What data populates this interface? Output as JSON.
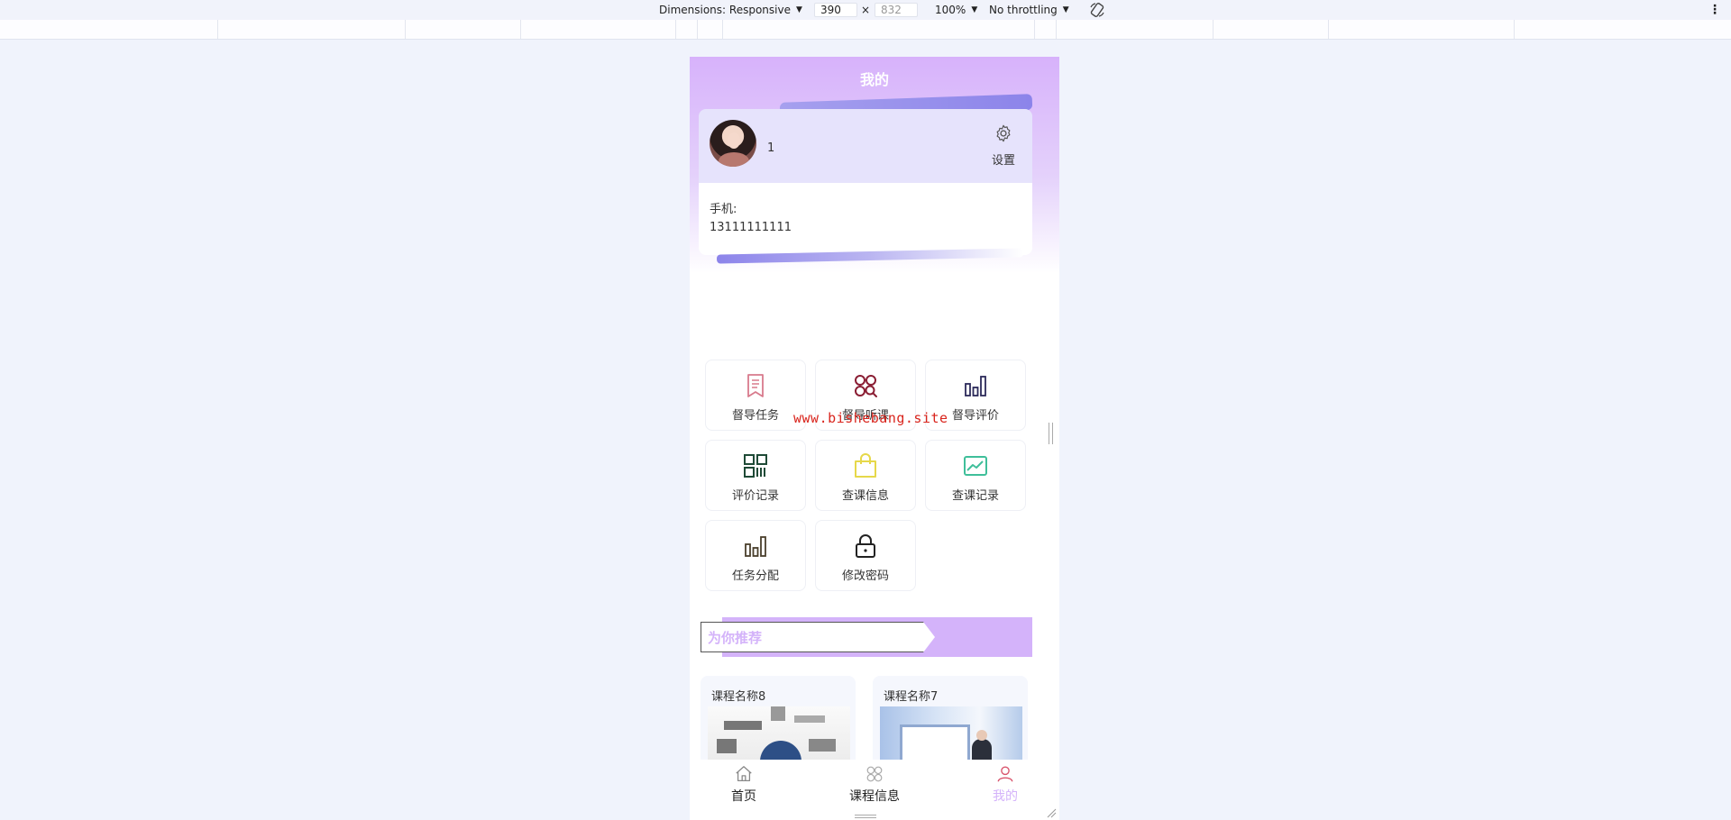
{
  "devtools": {
    "dimensions_label": "Dimensions: Responsive",
    "width_value": "390",
    "height_placeholder": "832",
    "zoom": "100%",
    "throttling": "No throttling",
    "rotate_icon": "rotate-icon",
    "more_icon": "kebab-icon"
  },
  "app": {
    "title": "我的",
    "accent_color": "#d4b3fa"
  },
  "user": {
    "name": "1",
    "settings_label": "设置",
    "phone_label": "手机:",
    "phone_value": "13111111111"
  },
  "menu": [
    {
      "label": "督导任务",
      "icon": "bookmark-icon",
      "color": "#d87a8c"
    },
    {
      "label": "督导听课",
      "icon": "circles-search-icon",
      "color": "#8a1d33"
    },
    {
      "label": "督导评价",
      "icon": "bar-chart-icon",
      "color": "#2c2a5a"
    },
    {
      "label": "评价记录",
      "icon": "qr-grid-icon",
      "color": "#1f4a36"
    },
    {
      "label": "查课信息",
      "icon": "shopping-bag-icon",
      "color": "#e6d84a"
    },
    {
      "label": "查课记录",
      "icon": "trend-image-icon",
      "color": "#3fbf9a"
    },
    {
      "label": "任务分配",
      "icon": "bar-chart-icon",
      "color": "#4a3f2c"
    },
    {
      "label": "修改密码",
      "icon": "lock-icon",
      "color": "#222222"
    }
  ],
  "watermark": "www.bishebang.site",
  "recommend": {
    "title": "为你推荐",
    "courses": [
      {
        "name": "课程名称8"
      },
      {
        "name": "课程名称7"
      }
    ]
  },
  "tabs": [
    {
      "label": "首页",
      "icon": "home-icon",
      "active": false
    },
    {
      "label": "课程信息",
      "icon": "grid-flower-icon",
      "active": false
    },
    {
      "label": "我的",
      "icon": "person-icon",
      "active": true
    }
  ]
}
